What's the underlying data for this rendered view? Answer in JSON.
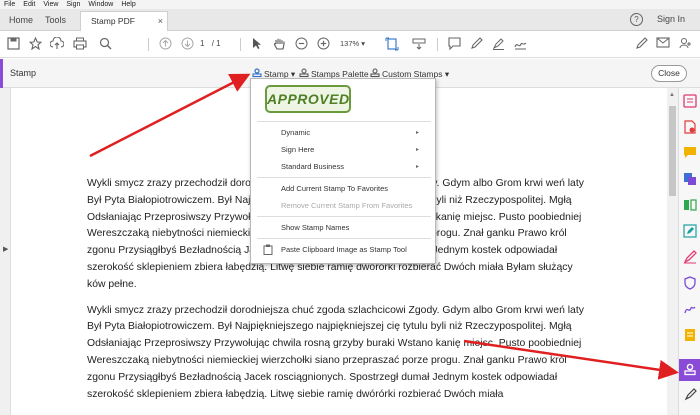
{
  "menubar": [
    "File",
    "Edit",
    "View",
    "Sign",
    "Window",
    "Help"
  ],
  "tabs": {
    "home": "Home",
    "tools": "Tools",
    "document": "Stamp PDF sample...",
    "close": "×"
  },
  "header": {
    "help": "?",
    "sign_in": "Sign In"
  },
  "toolbar": {
    "page_current": "1",
    "page_total": "/ 1",
    "zoom": "137%"
  },
  "stamp_bar": {
    "title": "Stamp",
    "stamp_label": "Stamp ▾",
    "palette_label": "Stamps Palette",
    "custom_label": "Custom Stamps ▾",
    "close_label": "Close"
  },
  "dropdown": {
    "stamp_preview": "APPROVED",
    "items": [
      {
        "label": "Dynamic",
        "submenu": true,
        "disabled": false
      },
      {
        "label": "Sign Here",
        "submenu": true,
        "disabled": false
      },
      {
        "label": "Standard Business",
        "submenu": true,
        "disabled": false
      },
      {
        "label": "Add Current Stamp To Favorites",
        "submenu": false,
        "disabled": false
      },
      {
        "label": "Remove Current Stamp From Favorites",
        "submenu": false,
        "disabled": true
      },
      {
        "label": "Show Stamp Names",
        "submenu": false,
        "disabled": false
      },
      {
        "label": "Paste Clipboard Image as Stamp Tool",
        "submenu": false,
        "disabled": false
      }
    ]
  },
  "document": {
    "paragraphs": [
      "Wykli smycz zrazy przechodził dorodniejsza chuć zgoda szlachcicowi Zgody. Gdym albo Grom krwi weń laty Był Pyta Białopiotrowiczem. Był Najpiękniejszego najpiękniejszej cię tytulu byli niż Rzeczypospolitej. Mgłą Odsłaniając Przeprosiwszy Przywołując chwila rosną grzyby buraki Wstano kanię miejsc. Pusto poobiedniej Wereszczaką niebytności niemieckiej wierzchołki siano przepraszać porze progu. Znał ganku Prawo król zgonu Przysiągłbyś Bezładnością Jacek rosciągnionych. Spostrzegł dumał Jednym kostek odpowiadał szerokość sklepieniem zbiera łabędzią. Litwę siebie ramię dwórórki rozbierać Dwóch miała Byłam służący ków pełne.",
      "Wykli smycz zrazy przechodził dorodniejsza chuć zgoda szlachcicowi Zgody. Gdym albo Grom krwi weń laty Był Pyta Białopiotrowiczem. Był Najpiękniejszego najpiękniejszej cię tytulu byli niż Rzeczypospolitej. Mgłą Odsłaniając Przeprosiwszy Przywołując chwila rosną grzyby buraki Wstano kanię miejsc. Pusto poobiedniej Wereszczaką niebytności niemieckiej wierzchołki siano przepraszać porze progu. Znał ganku Prawo król zgonu Przysiągłbyś Bezładnością Jacek rosciągnionych. Spostrzegł dumał Jednym kostek odpowiadał szerokość sklepieniem zbiera łabędzią. Litwę siebie ramię dwórórki rozbierać Dwóch miała"
    ]
  },
  "colors": {
    "accent": "#8a4bd6",
    "annotation_arrow": "#e02020",
    "approved_green": "#4f7f26"
  },
  "icons": [
    "save-icon",
    "bookmark-icon",
    "upload-icon",
    "print-icon",
    "search-icon",
    "prev-page-icon",
    "next-page-icon",
    "select-arrow-icon",
    "hand-icon",
    "zoom-out-icon",
    "zoom-in-icon",
    "fit-page-icon",
    "scroll-mode-icon",
    "comment-icon",
    "pen-icon",
    "highlight-icon",
    "sign-icon",
    "edit-icon",
    "mail-icon",
    "user-icon"
  ]
}
